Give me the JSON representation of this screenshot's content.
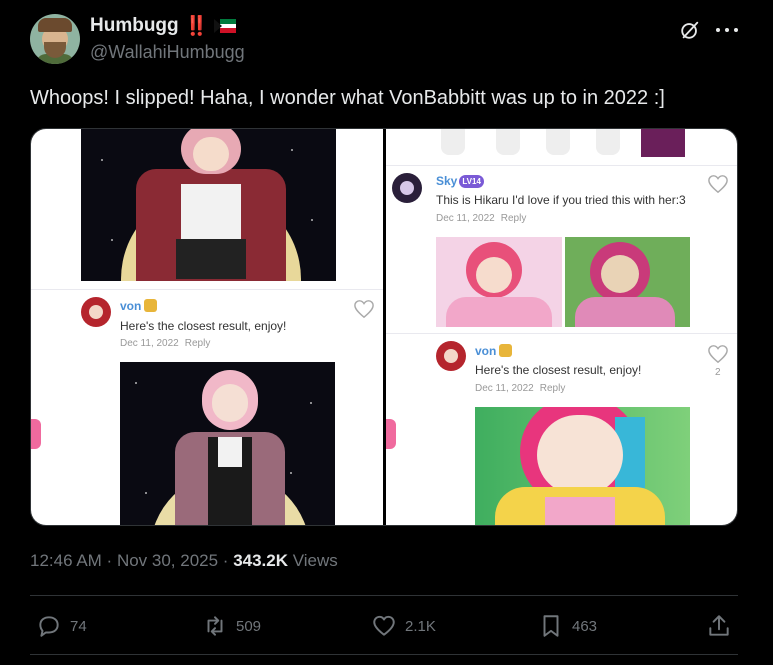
{
  "author": {
    "display_name": "Humbugg",
    "emoji_marks": "‼️",
    "flag_icon": "kuwait-flag-icon",
    "handle": "@WallahiHumbugg"
  },
  "header_icons": [
    "grok-icon",
    "more-icon"
  ],
  "tweet_text": "Whoops! I slipped! Haha, I wonder what VonBabbitt was up to in 2022 :]",
  "media": {
    "left": {
      "comment": {
        "name": "von",
        "text": "Here's the closest result, enjoy!",
        "date": "Dec 11, 2022",
        "reply": "Reply"
      }
    },
    "right": {
      "comment1": {
        "name": "Sky",
        "level": "LV14",
        "text": "This is Hikaru I'd love if you tried this with her:3",
        "date": "Dec 11, 2022",
        "reply": "Reply"
      },
      "comment2": {
        "name": "von",
        "text": "Here's the closest result, enjoy!",
        "date": "Dec 11, 2022",
        "reply": "Reply",
        "likes": "2"
      }
    }
  },
  "meta": {
    "time": "12:46 AM",
    "dot1": " · ",
    "date": "Nov 30, 2025",
    "dot2": " · ",
    "views_count": "343.2K",
    "views_label": " Views"
  },
  "actions": {
    "replies": "74",
    "reposts": "509",
    "likes": "2.1K",
    "bookmarks": "463"
  },
  "colors": {
    "background": "#000000",
    "text": "#e7e9ea",
    "muted": "#71767b",
    "border": "#2f3336",
    "link_blue": "#4a8fd6"
  }
}
